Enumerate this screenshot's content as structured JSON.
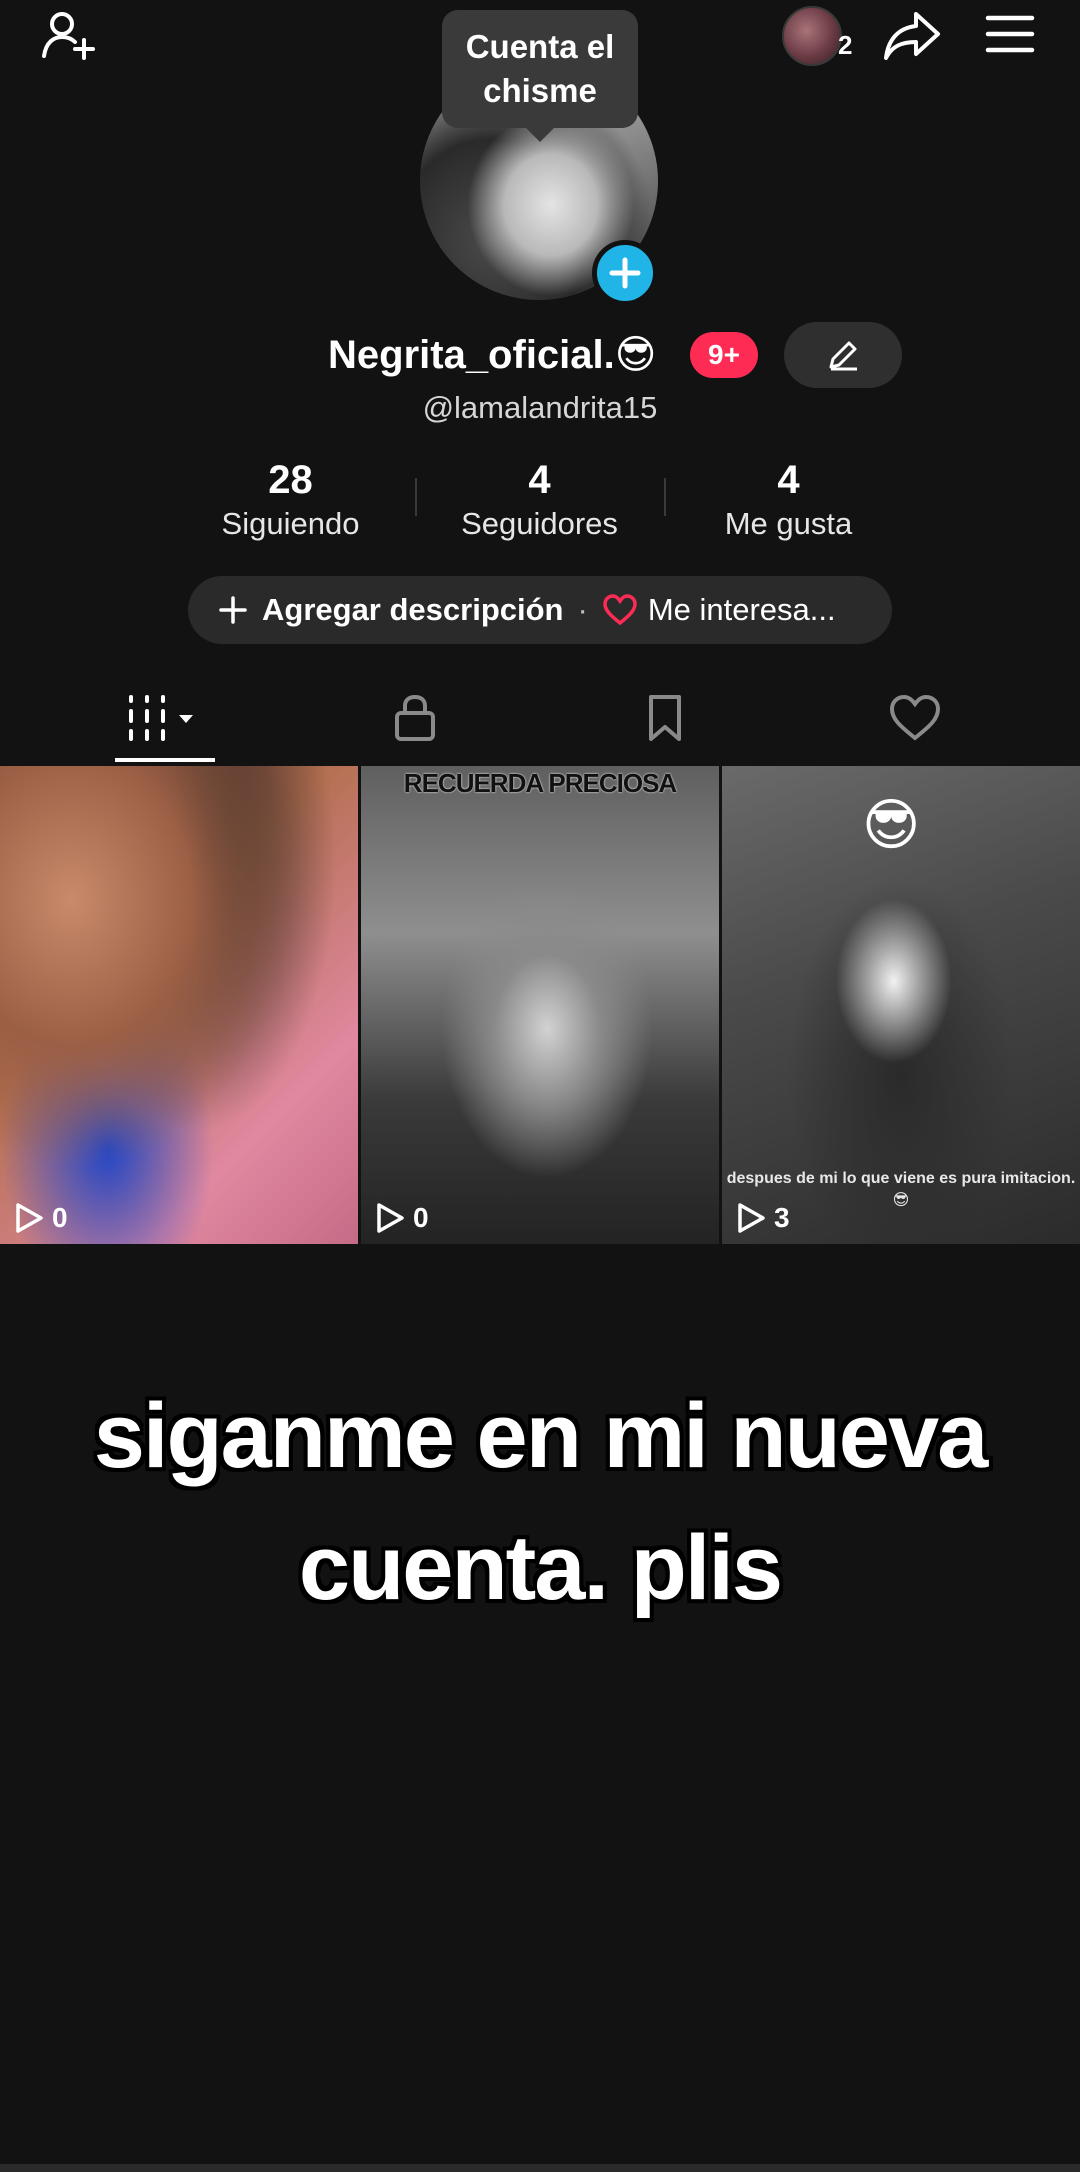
{
  "header": {
    "story_count": "2"
  },
  "profile": {
    "tooltip": "Cuenta el chisme",
    "display_name": "Negrita_oficial.😎",
    "badge": "9+",
    "username": "@lamalandrita15"
  },
  "stats": [
    {
      "value": "28",
      "label": "Siguiendo"
    },
    {
      "value": "4",
      "label": "Seguidores"
    },
    {
      "value": "4",
      "label": "Me gusta"
    }
  ],
  "description": {
    "add_label": "Agregar descripción",
    "separator": "·",
    "interests_label": "Me interesa..."
  },
  "tabs": [
    {
      "icon": "grid-videos-icon",
      "active": true
    },
    {
      "icon": "lock-icon",
      "active": false
    },
    {
      "icon": "bookmark-icon",
      "active": false
    },
    {
      "icon": "heart-icon",
      "active": false
    }
  ],
  "videos": [
    {
      "plays": "0",
      "caption_top": "",
      "caption_bottom": ""
    },
    {
      "plays": "0",
      "caption_top": "RECUERDA PRECIOSA",
      "caption_bottom": ""
    },
    {
      "plays": "3",
      "caption_top": "",
      "emoji": "😎",
      "caption_bottom": "despues de mi lo que viene es pura imitacion.😎"
    }
  ],
  "overlay_text": "siganme en mi nueva cuenta. plis",
  "colors": {
    "background": "#121212",
    "badge": "#fe2c55",
    "follow_plus": "#20b5e6",
    "heart": "#fe2c55"
  }
}
